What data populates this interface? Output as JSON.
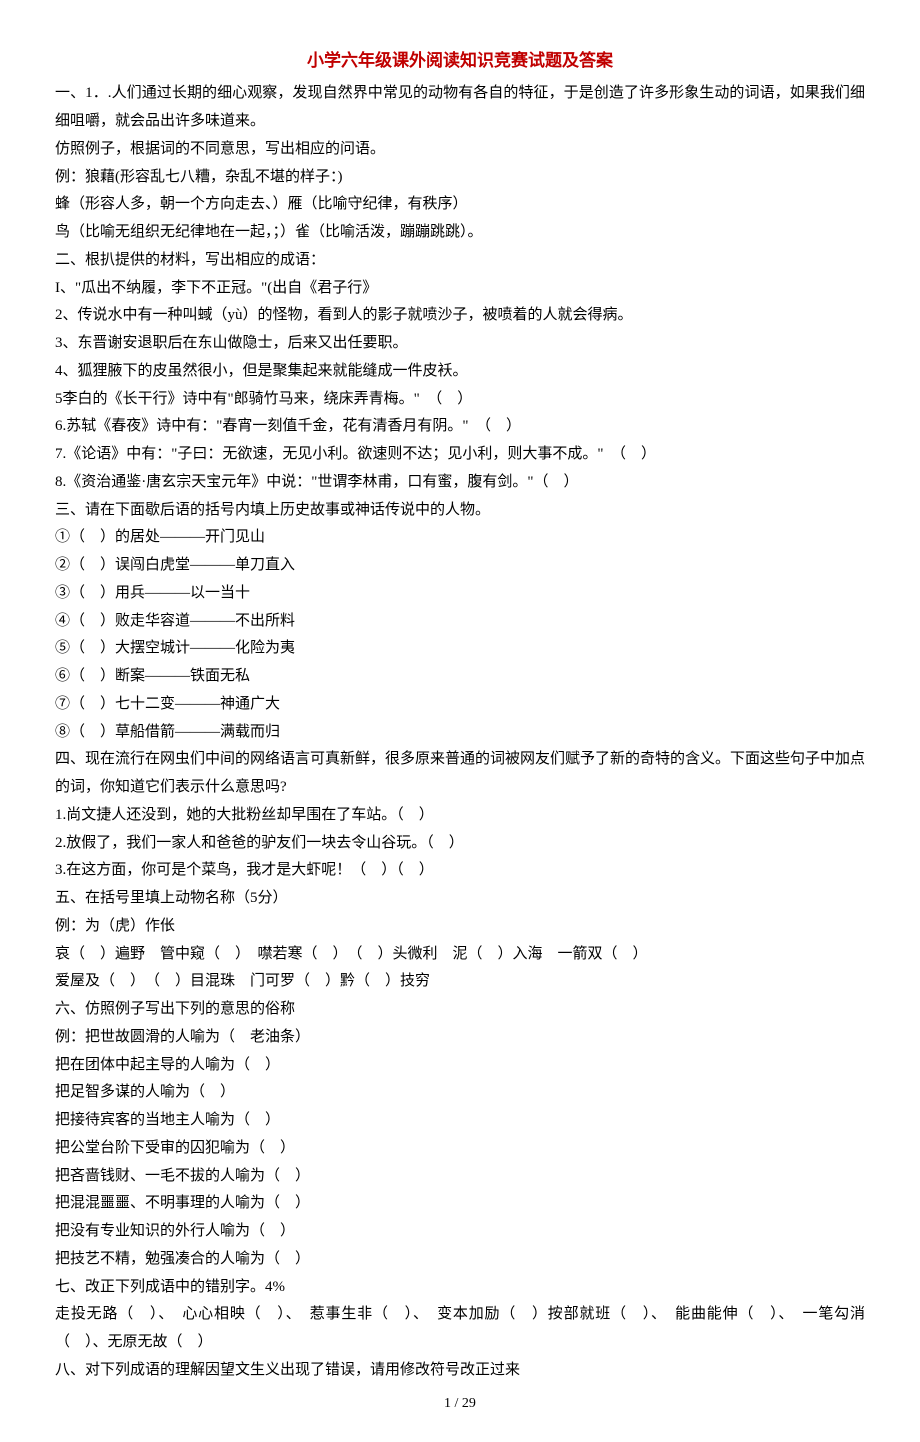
{
  "title": "小学六年级课外阅读知识竞赛试题及答案",
  "lines": [
    "一、1．.人们通过长期的细心观察，发现自然界中常见的动物有各自的特征，于是创造了许多形象生动的词语，如果我们细细咀嚼，就会品出许多味道来。",
    "仿照例子，根据词的不同意思，写出相应的问语。",
    "例：狼藉(形容乱七八糟，杂乱不堪的样子：)",
    "蜂（形容人多，朝一个方向走去、）雁（比喻守纪律，有秩序）",
    "鸟（比喻无组织无纪律地在一起，；）雀（比喻活泼，蹦蹦跳跳）。",
    "二、根扒提供的材料，写出相应的成语：",
    "I、\"瓜出不纳履，李下不正冠。\"(出自《君子行》",
    "2、传说水中有一种叫蜮（yù）的怪物，看到人的影子就喷沙子，被喷着的人就会得病。",
    "3、东晋谢安退职后在东山做隐士，后来又出任要职。",
    "4、狐狸腋下的皮虽然很小，但是聚集起来就能缝成一件皮袄。",
    "5李白的《长干行》诗中有\"郎骑竹马来，绕床弄青梅。\"　（　）",
    "6.苏轼《春夜》诗中有：\"春宵一刻值千金，花有清香月有阴。\"　（　）",
    "7.《论语》中有：\"子曰：无欲速，无见小利。欲速则不达；见小利，则大事不成。\"　（　）",
    "8.《资治通鉴·唐玄宗天宝元年》中说：\"世谓李林甫，口有蜜，腹有剑。\"（　）",
    "三、请在下面歇后语的括号内填上历史故事或神话传说中的人物。",
    "①（　）的居处———开门见山",
    "②（　）误闯白虎堂———单刀直入",
    "③（　）用兵———以一当十",
    "④（　）败走华容道———不出所料",
    "⑤（　）大摆空城计———化险为夷",
    "⑥（　）断案———铁面无私",
    "⑦（　）七十二变———神通广大",
    "⑧（　）草船借箭———满载而归",
    "四、现在流行在网虫们中间的网络语言可真新鲜，很多原来普通的词被网友们赋予了新的奇特的含义。下面这些句子中加点的词，你知道它们表示什么意思吗?",
    "1.尚文捷人还没到，她的大批粉丝却早围在了车站。（　）",
    "2.放假了，我们一家人和爸爸的驴友们一块去令山谷玩。（　）",
    "3.在这方面，你可是个菜鸟，我才是大虾呢！（　）（　）",
    "五、在括号里填上动物名称（5分）",
    "例：为（虎）作伥",
    "哀（　）遍野　管中窥（　）　噤若寒（　）　（　）头微利　泥（　）入海　一箭双（　）",
    "爱屋及（　）　（　）目混珠　门可罗（　）黔（　）技穷",
    "六、仿照例子写出下列的意思的俗称",
    "例：把世故圆滑的人喻为（　老油条）",
    "把在团体中起主导的人喻为（　）",
    "把足智多谋的人喻为（　）",
    "把接待宾客的当地主人喻为（　）",
    "把公堂台阶下受审的囚犯喻为（　）",
    "把吝啬钱财、一毛不拔的人喻为（　）",
    "把混混噩噩、不明事理的人喻为（　）",
    "把没有专业知识的外行人喻为（　）",
    "把技艺不精，勉强凑合的人喻为（　）",
    "七、改正下列成语中的错别字。4%",
    "走投无路（　）、　心心相映（　）、　惹事生非（　）、　变本加励（　）按部就班（　）、　能曲能伸（　）、　一笔勾消（　）、无原无故（　）",
    "八、对下列成语的理解因望文生义出现了错误，请用修改符号改正过来"
  ],
  "footer": "1 / 29"
}
